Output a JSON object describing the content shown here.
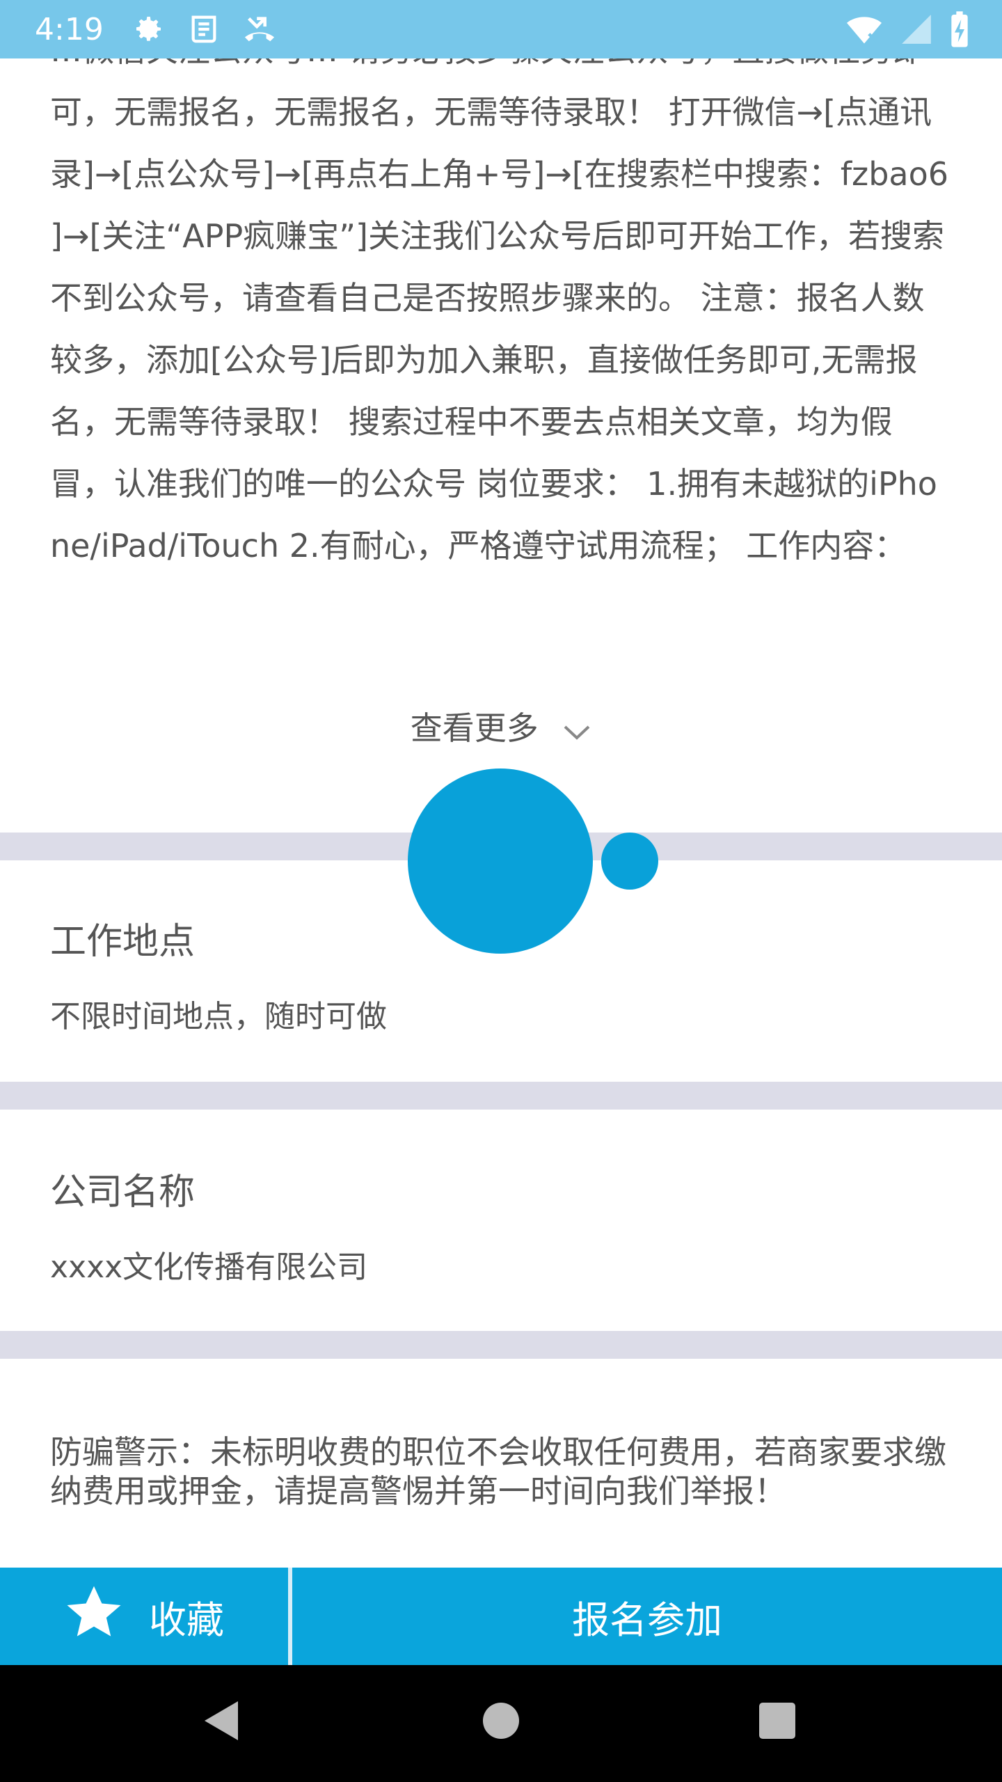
{
  "status_bar": {
    "time": "4:19",
    "icons_left": [
      "gear-icon",
      "news-icon",
      "missed-call-icon"
    ],
    "icons_right": [
      "wifi-icon",
      "signal-icon",
      "battery-icon"
    ]
  },
  "job": {
    "description": "…微信关注公众号… 请务必按步骤关注公众号，直接做任务即可，无需报名，无需报名，无需等待录取！ 打开微信→[点通讯录]→[点公众号]→[再点右上角+号]→[在搜索栏中搜索：fzbao6 ]→[关注“APP疯赚宝”]关注我们公众号后即可开始工作，若搜索不到公众号，请查看自己是否按照步骤来的。 注意：报名人数较多，添加[公众号]后即为加入兼职，直接做任务即可,无需报名，无需等待录取！ 搜索过程中不要去点相关文章，均为假冒，认准我们的唯一的公众号 岗位要求： 1.拥有未越狱的iPhone/iPad/iTouch 2.有耐心，严格遵守试用流程； 工作内容：",
    "see_more": "查看更多"
  },
  "location": {
    "title": "工作地点",
    "value": "不限时间地点，随时可做"
  },
  "company": {
    "title": "公司名称",
    "value": "xxxx文化传播有限公司"
  },
  "warning": "防骗警示：未标明收费的职位不会收取任何费用，若商家要求缴纳费用或押金，请提高警惕并第一时间向我们举报！",
  "actions": {
    "favorite": "收藏",
    "apply": "报名参加"
  },
  "colors": {
    "status_bar": "#77c7ea",
    "accent": "#0aa5dc",
    "divider": "#dcdce8",
    "text": "#555555"
  }
}
